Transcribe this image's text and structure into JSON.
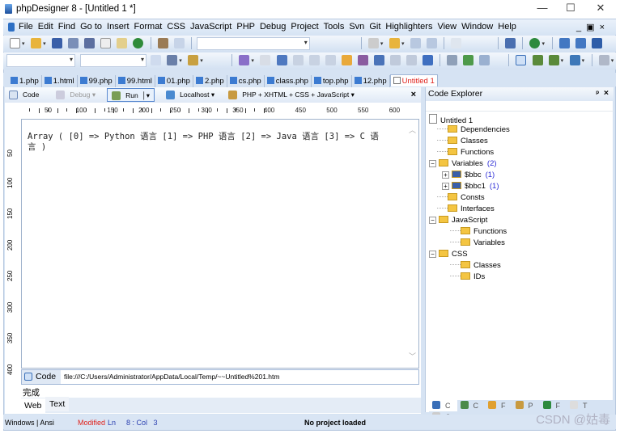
{
  "window": {
    "title": "phpDesigner 8 - [Untitled 1 *]",
    "minimize": "—",
    "maximize": "☐",
    "close": "✕"
  },
  "menu": [
    "File",
    "Edit",
    "Find",
    "Go to",
    "Insert",
    "Format",
    "CSS",
    "JavaScript",
    "PHP",
    "Debug",
    "Project",
    "Tools",
    "Svn",
    "Git",
    "Highlighters",
    "View",
    "Window",
    "Help"
  ],
  "mdi": {
    "min": "_",
    "restore": "▣",
    "close": "×"
  },
  "tabs": [
    "1.php",
    "1.html",
    "99.php",
    "99.html",
    "01.php",
    "2.php",
    "cs.php",
    "class.php",
    "top.php",
    "12.php",
    "Untitled 1"
  ],
  "editor_toolbar": {
    "code": "Code",
    "debug": "Debug",
    "run": "Run",
    "localhost": "Localhost",
    "highlighter": "PHP + XHTML + CSS + JavaScript",
    "close": "×"
  },
  "ruler": {
    "h": [
      "50",
      "100",
      "150",
      "200",
      "250",
      "300",
      "350",
      "400",
      "450",
      "500",
      "550",
      "600"
    ],
    "v": [
      "50",
      "100",
      "150",
      "200",
      "250",
      "300",
      "350",
      "400"
    ]
  },
  "output": {
    "line1": "Array ( [0] => Python 语言 [1] => PHP 语言 [2] => Java 语言 [3] => C 语",
    "line2": "言 )"
  },
  "browser": {
    "code_button": "Code",
    "url": "file:///C:/Users/Administrator/AppData/Local/Temp/~~Untitled%201.htm",
    "status": "完成",
    "tab_web": "Web",
    "tab_text": "Text"
  },
  "status": {
    "encoding": "Windows | Ansi",
    "modified": "Modified",
    "ln": "Ln",
    "pos": "8 : Col   3",
    "project": "No project loaded"
  },
  "explorer": {
    "title": "Code Explorer",
    "pin": "ᵖ",
    "close": "×",
    "tree": [
      {
        "label": "Untitled 1",
        "level": 0
      },
      {
        "label": "Dependencies",
        "level": 1
      },
      {
        "label": "Classes",
        "level": 1
      },
      {
        "label": "Functions",
        "level": 1
      },
      {
        "label": "Variables",
        "level": 1,
        "count": "(2)",
        "expanded": true
      },
      {
        "label": "$bbc",
        "level": 2,
        "count": "(1)"
      },
      {
        "label": "$bbc1",
        "level": 2,
        "count": "(1)"
      },
      {
        "label": "Consts",
        "level": 1
      },
      {
        "label": "Interfaces",
        "level": 1
      },
      {
        "label": "JavaScript",
        "level": 1,
        "expanded": true
      },
      {
        "label": "Functions",
        "level": 2
      },
      {
        "label": "Variables",
        "level": 2
      },
      {
        "label": "CSS",
        "level": 1,
        "expanded": true
      },
      {
        "label": "Classes",
        "level": 2
      },
      {
        "label": "IDs",
        "level": 2
      }
    ],
    "bottom_tabs": [
      "C",
      "C",
      "F",
      "P",
      "F",
      "T",
      "C"
    ]
  },
  "watermark": "CSDN @姑毒"
}
